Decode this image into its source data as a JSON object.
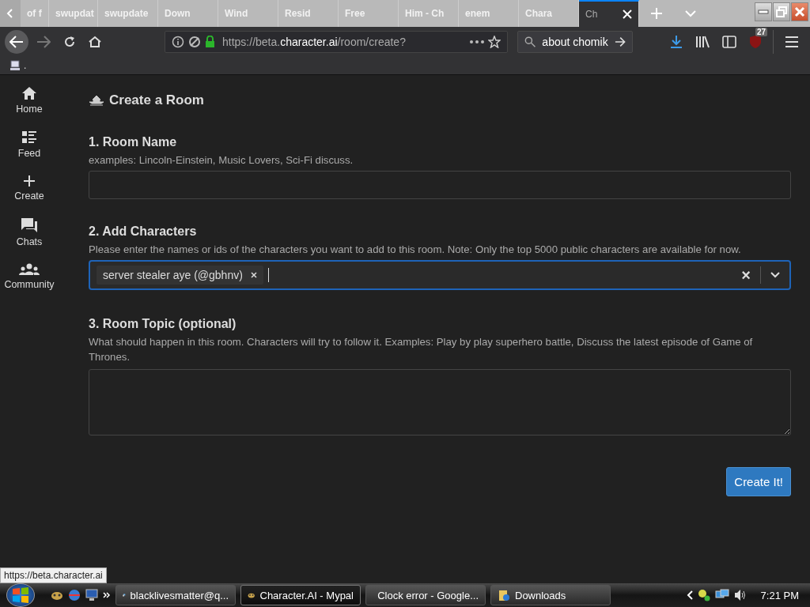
{
  "browser": {
    "tabs": [
      {
        "label": "of f",
        "selected": false
      },
      {
        "label": "swupdat",
        "selected": false
      },
      {
        "label": "swupdate",
        "selected": false
      },
      {
        "label": "Down",
        "selected": false
      },
      {
        "label": "Wind",
        "selected": false
      },
      {
        "label": "Resid",
        "selected": false
      },
      {
        "label": "Free",
        "selected": false
      },
      {
        "label": "Him - Ch",
        "selected": false
      },
      {
        "label": "enem",
        "selected": false
      },
      {
        "label": "Chara",
        "selected": false
      },
      {
        "label": "Ch",
        "selected": true
      }
    ],
    "url": {
      "prefix": "https://beta.",
      "domain": "character.ai",
      "path": "/room/create?"
    },
    "search_value": "about chomik",
    "addon_badge": "27",
    "bookmark": "."
  },
  "sidebar": {
    "items": [
      {
        "label": "Home"
      },
      {
        "label": "Feed"
      },
      {
        "label": "Create"
      },
      {
        "label": "Chats"
      },
      {
        "label": "Community"
      }
    ]
  },
  "page": {
    "title": "Create a Room",
    "room_name": {
      "heading": "1. Room Name",
      "hint": "examples: Lincoln-Einstein, Music Lovers, Sci-Fi discuss."
    },
    "characters": {
      "heading": "2. Add Characters",
      "hint": "Please enter the names or ids of the characters you want to add to this room. Note: Only the top 5000 public characters are available for now.",
      "chips": [
        {
          "label": "server stealer aye (@gbhnv)"
        }
      ],
      "clear": "×"
    },
    "topic": {
      "heading": "3. Room Topic (optional)",
      "hint": "What should happen in this room. Characters will try to follow it. Examples: Play by play superhero battle, Discuss the latest episode of Game of Thrones."
    },
    "submit": "Create It!"
  },
  "status_url": "https://beta.character.ai",
  "taskbar": {
    "tasks": [
      {
        "label": "blacklivesmatter@q...",
        "selected": false
      },
      {
        "label": "Character.AI - Mypal",
        "selected": true
      },
      {
        "label": "Clock error - Google...",
        "selected": false
      },
      {
        "label": "Downloads",
        "selected": false
      }
    ],
    "clock": "7:21 PM"
  }
}
